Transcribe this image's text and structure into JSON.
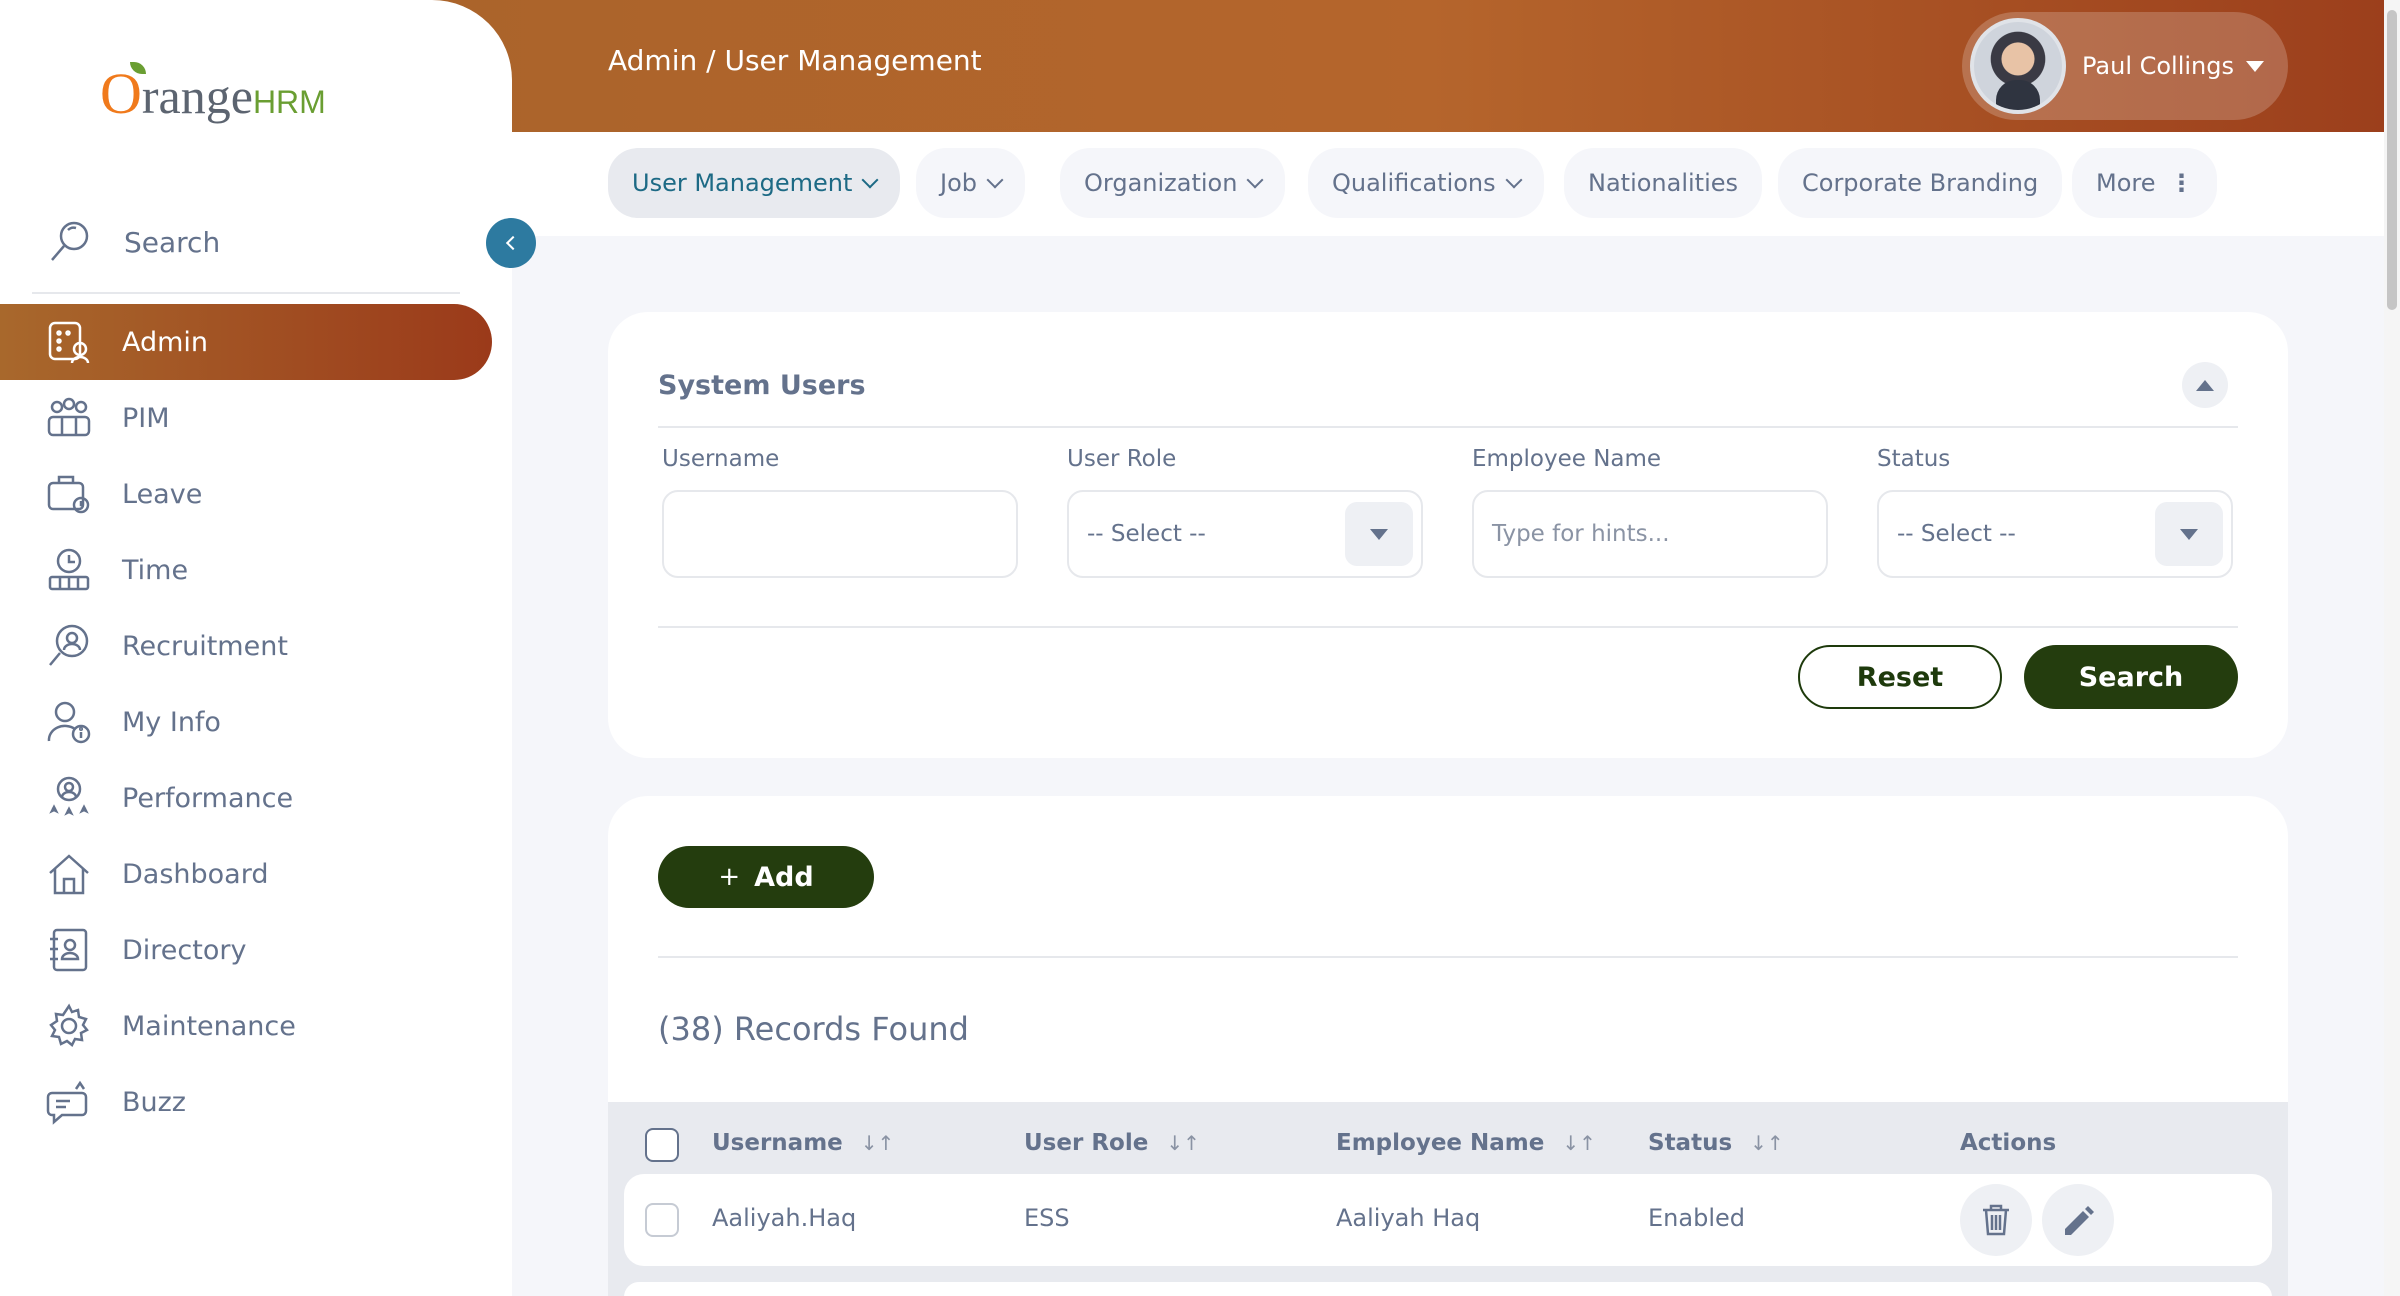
{
  "header": {
    "breadcrumb": "Admin / User Management",
    "user_name": "Paul Collings"
  },
  "brand": {
    "logo_o": "O",
    "logo_range": "range",
    "logo_hrm": "HRM"
  },
  "subnav": {
    "tabs": [
      {
        "label": "User Management"
      },
      {
        "label": "Job"
      },
      {
        "label": "Organization"
      },
      {
        "label": "Qualifications"
      },
      {
        "label": "Nationalities"
      },
      {
        "label": "Corporate Branding"
      },
      {
        "label": "More"
      }
    ]
  },
  "sidebar": {
    "search_label": "Search",
    "items": [
      {
        "label": "Admin"
      },
      {
        "label": "PIM"
      },
      {
        "label": "Leave"
      },
      {
        "label": "Time"
      },
      {
        "label": "Recruitment"
      },
      {
        "label": "My Info"
      },
      {
        "label": "Performance"
      },
      {
        "label": "Dashboard"
      },
      {
        "label": "Directory"
      },
      {
        "label": "Maintenance"
      },
      {
        "label": "Buzz"
      }
    ]
  },
  "filter": {
    "title": "System Users",
    "username_label": "Username",
    "username_value": "",
    "user_role_label": "User Role",
    "user_role_value": "-- Select --",
    "employee_name_label": "Employee Name",
    "employee_name_placeholder": "Type for hints...",
    "status_label": "Status",
    "status_value": "-- Select --",
    "reset_label": "Reset",
    "search_label": "Search"
  },
  "list": {
    "add_plus": "+",
    "add_label": "Add",
    "records_found": "(38) Records Found",
    "columns": {
      "username": "Username",
      "user_role": "User Role",
      "employee_name": "Employee Name",
      "status": "Status",
      "actions": "Actions"
    },
    "rows": [
      {
        "username": "Aaliyah.Haq",
        "user_role": "ESS",
        "employee_name": "Aaliyah Haq",
        "status": "Enabled"
      }
    ]
  },
  "icons": {
    "sort": "sort-icon",
    "delete": "trash-icon",
    "edit": "pencil-icon"
  },
  "colors": {
    "brand_gradient_start": "#a6642a",
    "brand_gradient_end": "#9c3f1c",
    "primary_button": "#243d0e",
    "collapse_button": "#2d7aa0",
    "active_tab_text": "#1d6a85"
  }
}
